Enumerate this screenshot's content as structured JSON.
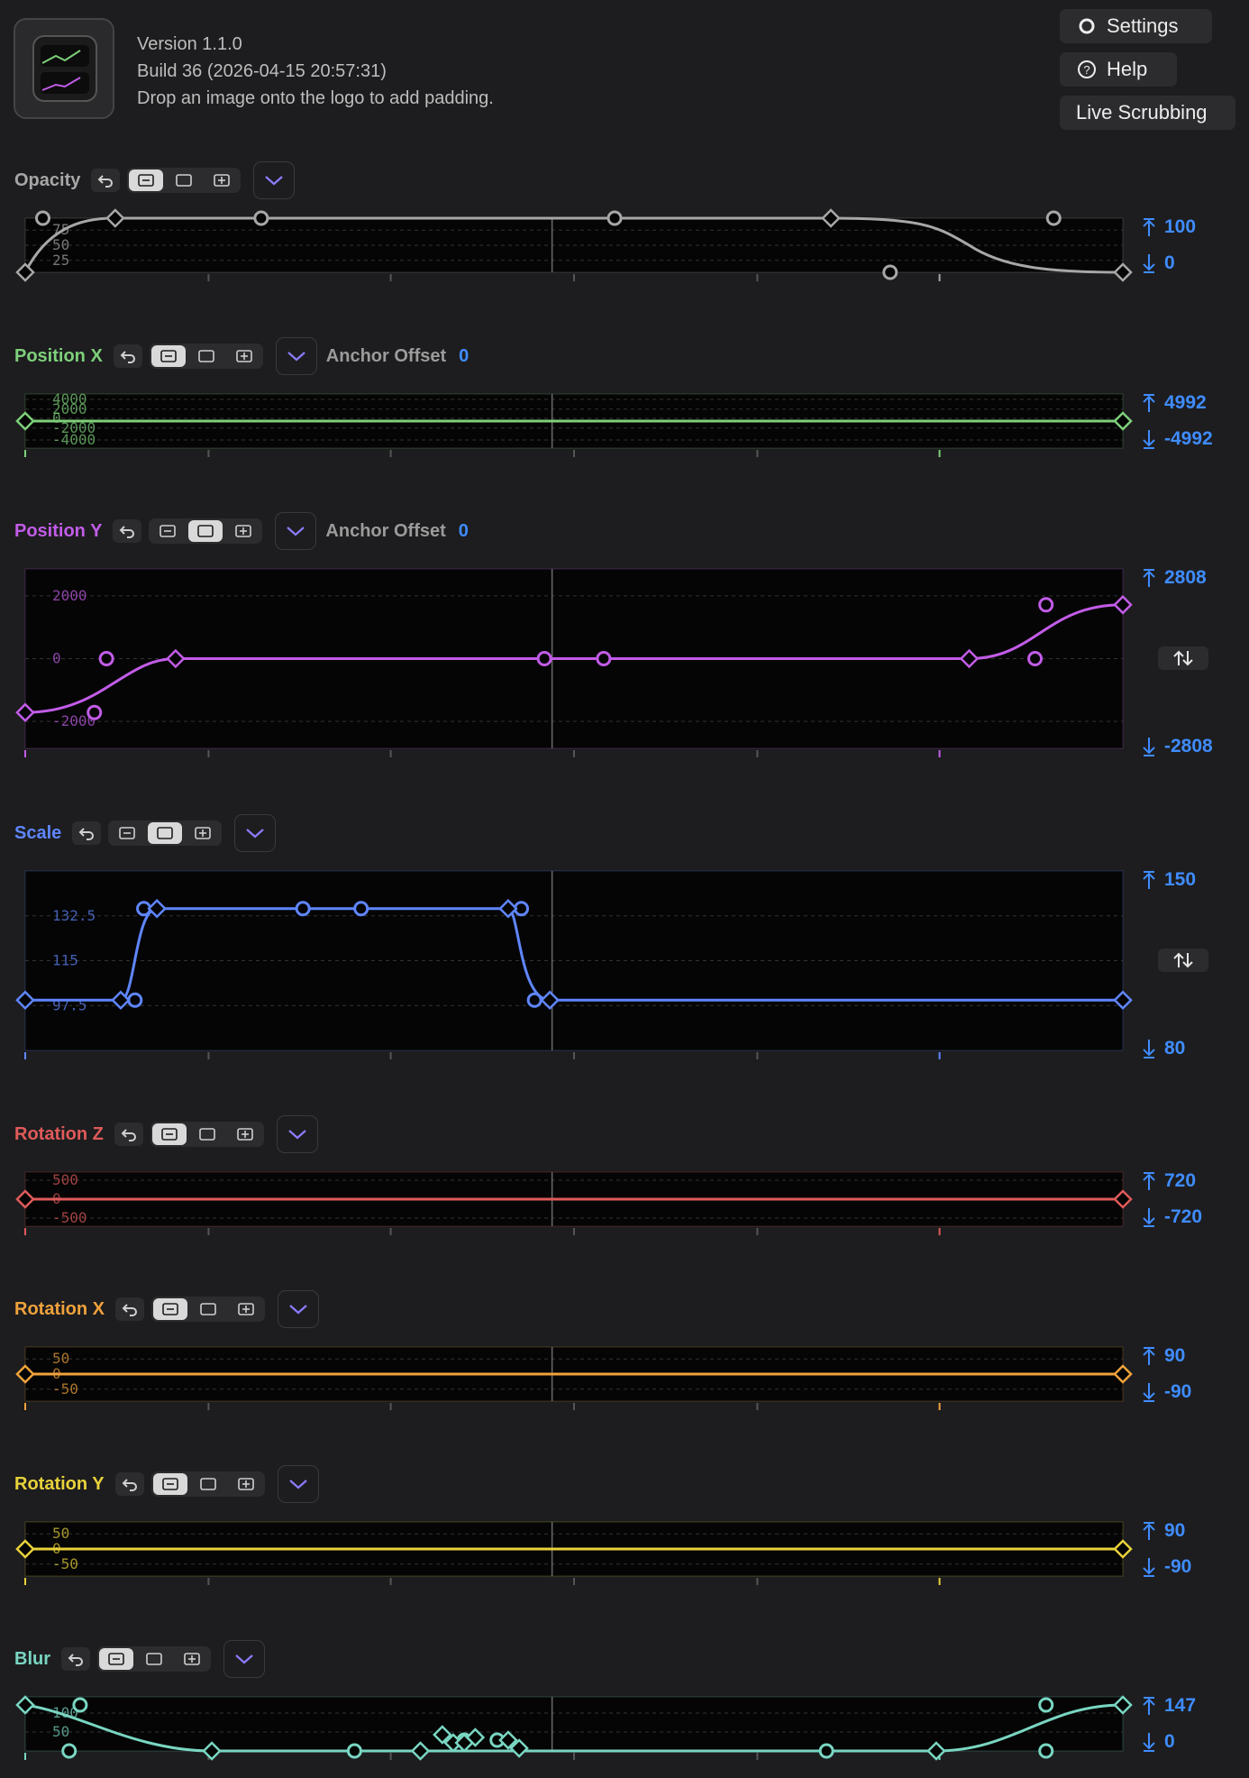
{
  "header": {
    "version": "Version 1.1.0",
    "build": "Build 36 (2026-04-15 20:57:31)",
    "hint": "Drop an image onto the logo to add padding.",
    "settings_label": "Settings",
    "help_label": "Help",
    "live_label": "Live Scrubbing"
  },
  "tracks": [
    {
      "name": "Opacity",
      "color": "#a7a7a7",
      "max": "100",
      "min": "0",
      "ticks": [
        "75",
        "50",
        "25"
      ]
    },
    {
      "name": "Position X",
      "color": "#7ed07a",
      "max": "4992",
      "min": "-4992",
      "anchor_label": "Anchor Offset",
      "anchor_value": "0",
      "ticks": [
        "4000",
        "2000",
        "0",
        "-2000",
        "-4000"
      ]
    },
    {
      "name": "Position Y",
      "color": "#c25ce8",
      "max": "2808",
      "min": "-2808",
      "anchor_label": "Anchor Offset",
      "anchor_value": "0",
      "ticks": [
        "2000",
        "0",
        "-2000"
      ]
    },
    {
      "name": "Scale",
      "color": "#5f86ff",
      "max": "150",
      "min": "80",
      "ticks": [
        "132.5",
        "115",
        "97.5"
      ]
    },
    {
      "name": "Rotation Z",
      "color": "#e05a5a",
      "max": "720",
      "min": "-720",
      "ticks": [
        "500",
        "0",
        "-500"
      ]
    },
    {
      "name": "Rotation X",
      "color": "#f0a23c",
      "max": "90",
      "min": "-90",
      "ticks": [
        "50",
        "0",
        "-50"
      ]
    },
    {
      "name": "Rotation Y",
      "color": "#e8d23a",
      "max": "90",
      "min": "-90",
      "ticks": [
        "50",
        "0",
        "-50"
      ]
    },
    {
      "name": "Blur",
      "color": "#79d6c2",
      "max": "147",
      "min": "0",
      "ticks": [
        "100",
        "50"
      ]
    }
  ]
}
